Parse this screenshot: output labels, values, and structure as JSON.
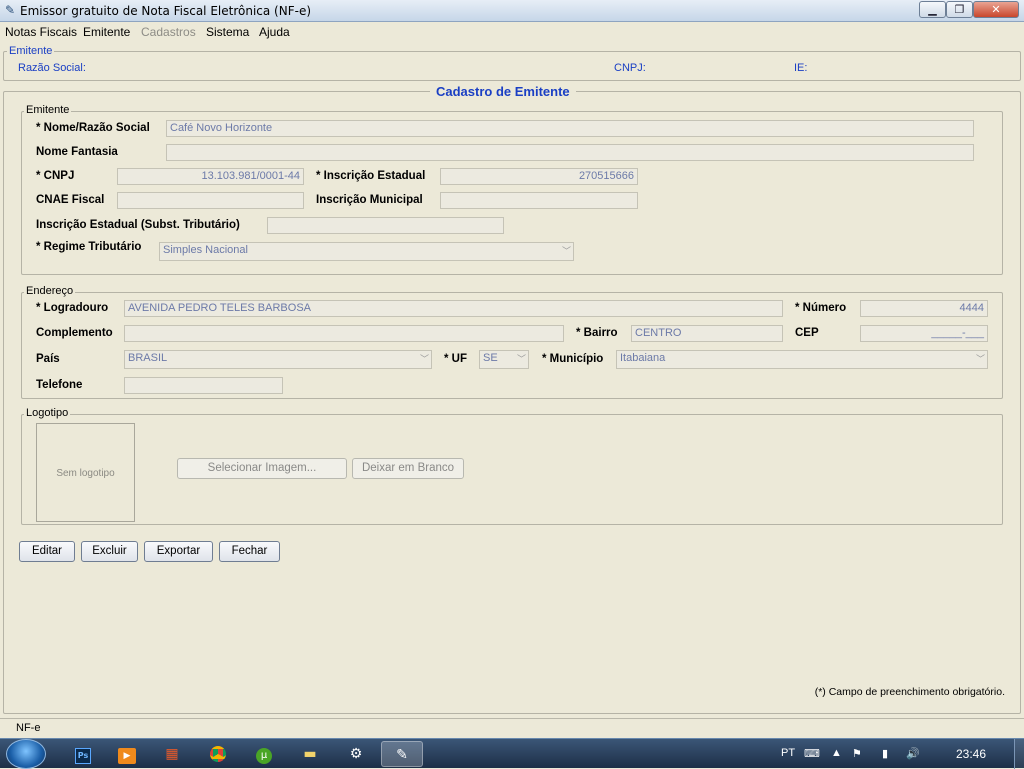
{
  "window": {
    "title": "Emissor gratuito de Nota Fiscal Eletrônica (NF-e)",
    "min": "▁",
    "max": "❐",
    "close": "✕"
  },
  "menu": [
    "Notas Fiscais",
    "Emitente",
    "Cadastros",
    "Sistema",
    "Ajuda"
  ],
  "header": {
    "legend": "Emitente",
    "razao_label": "Razão Social:",
    "cnpj_label": "CNPJ:",
    "ie_label": "IE:"
  },
  "form": {
    "title": "Cadastro de Emitente",
    "emitente": {
      "legend": "Emitente",
      "nome_label": "* Nome/Razão Social",
      "nome_value": "Café Novo Horizonte",
      "fantasia_label": "Nome Fantasia",
      "fantasia_value": "",
      "cnpj_label": "* CNPJ",
      "cnpj_value": "13.103.981/0001-44",
      "ie_label": "* Inscrição Estadual",
      "ie_value": "270515666",
      "cnae_label": "CNAE Fiscal",
      "cnae_value": "",
      "im_label": "Inscrição Municipal",
      "im_value": "",
      "iest_label": "Inscrição Estadual (Subst. Tributário)",
      "iest_value": "",
      "regime_label": "* Regime Tributário",
      "regime_value": "Simples Nacional"
    },
    "endereco": {
      "legend": "Endereço",
      "logradouro_label": "* Logradouro",
      "logradouro_value": "AVENIDA PEDRO TELES BARBOSA",
      "numero_label": "* Número",
      "numero_value": "4444",
      "complemento_label": "Complemento",
      "complemento_value": "",
      "bairro_label": "* Bairro",
      "bairro_value": "CENTRO",
      "cep_label": "CEP",
      "cep_value": "_____-___",
      "pais_label": "País",
      "pais_value": "BRASIL",
      "uf_label": "* UF",
      "uf_value": "SE",
      "municipio_label": "* Município",
      "municipio_value": "Itabaiana",
      "telefone_label": "Telefone",
      "telefone_value": ""
    },
    "logotipo": {
      "legend": "Logotipo",
      "placeholder": "Sem logotipo",
      "select_button": "Selecionar Imagem...",
      "blank_button": "Deixar em Branco"
    },
    "actions": {
      "editar": "Editar",
      "excluir": "Excluir",
      "exportar": "Exportar",
      "fechar": "Fechar"
    },
    "footnote": "(*) Campo de preenchimento obrigatório."
  },
  "status": "NF-e",
  "taskbar": {
    "lang": "PT",
    "clock": "23:46",
    "icons": [
      "start-orb",
      "photoshop-icon",
      "media-player-icon",
      "firewall-icon",
      "chrome-icon",
      "utorrent-icon",
      "explorer-icon",
      "settings-icon",
      "nfe-app-icon"
    ]
  }
}
